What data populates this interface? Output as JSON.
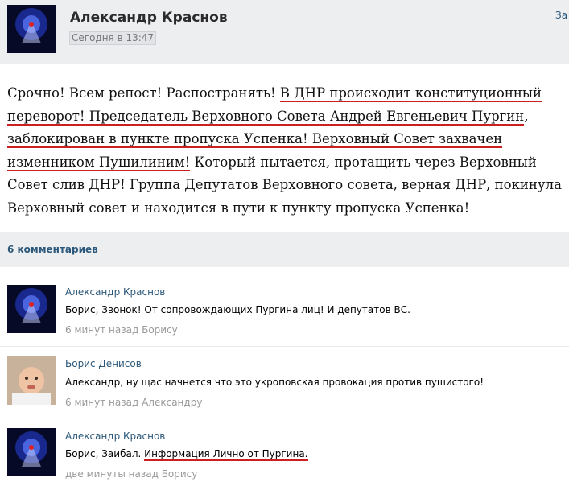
{
  "post": {
    "author": "Александр Краснов",
    "time": "Сегодня в 13:47",
    "top_link": "За",
    "text_parts": [
      "Срочно! Всем репост! Распостранять! ",
      "В ДНР происходит конституционный",
      " ",
      "переворот! Председатель Верховного Совета Андрей Евгеньевич Пургин",
      ", ",
      "заблокирован в пункте пропуска Успенка! Верховный Совет захвачен",
      " ",
      "изменником Пушилиним!",
      " Который пытается, протащить через Верховный Совет слив ДНР! Группа Депутатов Верховного совета, верная ДНР, покинула Верховный совет и находится в пути к пункту пропуска Успенка!"
    ]
  },
  "comments_header": {
    "count_label": "6 комментариев"
  },
  "comments": [
    {
      "name": "Александр Краснов",
      "text": "Борис, Звонок! От сопровождающих Пургина лиц! И депутатов ВС.",
      "meta": "6 минут назад Борису"
    },
    {
      "name": "Борис Денисов",
      "text": "Александр, ну щас начнется что это укроповская провокация против пушистого!",
      "meta": "6 минут назад Александру"
    },
    {
      "name": "Александр Краснов",
      "text_plain": "Борис, Заибал. ",
      "text_highlight": "Информация Лично от Пургина.",
      "meta": "две минуты назад Борису"
    }
  ],
  "colors": {
    "highlight_underline": "#cc1f1f",
    "link": "#2b587a",
    "header_bg": "#edeef0"
  }
}
